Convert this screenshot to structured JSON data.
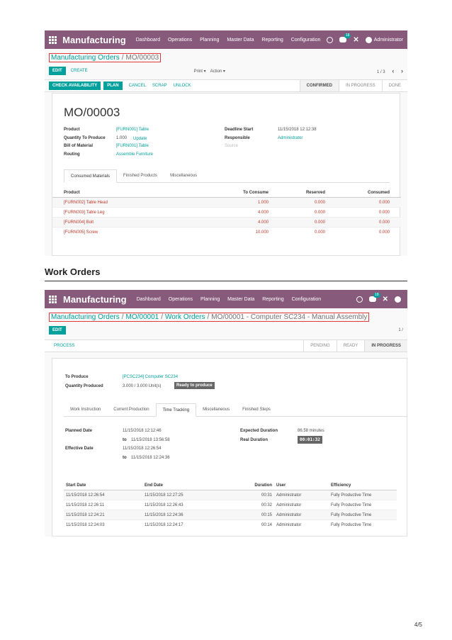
{
  "section_heading": "Work Orders",
  "page_number": "4/5",
  "screen1": {
    "topbar": {
      "brand": "Manufacturing",
      "menu": [
        "Dashboard",
        "Operations",
        "Planning",
        "Master Data",
        "Reporting",
        "Configuration"
      ],
      "chat_badge": "18",
      "user": "Administrator"
    },
    "breadcrumb": {
      "link": "Manufacturing Orders",
      "sep": "/",
      "current": "MO/00003"
    },
    "buttons": {
      "edit": "EDIT",
      "create": "CREATE",
      "print": "Print ▾",
      "action": "Action ▾"
    },
    "pager": {
      "text": "1 / 3",
      "prev": "‹",
      "next": "›"
    },
    "actions": {
      "check": "CHECK AVAILABILITY",
      "plan": "PLAN",
      "cancel": "CANCEL",
      "scrap": "SCRAP",
      "unlock": "UNLOCK"
    },
    "stages": [
      "CONFIRMED",
      "IN PROGRESS",
      "DONE"
    ],
    "record_title": "MO/00003",
    "fields": {
      "product_label": "Product",
      "product": "[FURN001] Table",
      "qty_label": "Quantity To Produce",
      "qty": "1.000",
      "qty_update": "Update",
      "bom_label": "Bill of Material",
      "bom": "[FURN001] Table",
      "routing_label": "Routing",
      "routing": "Assemble Furniture",
      "deadline_label": "Deadline Start",
      "deadline": "11/15/2018 12:12:38",
      "responsible_label": "Responsible",
      "responsible": "Administrator",
      "source_label": "Source"
    },
    "tabs": [
      "Consumed Materials",
      "Finished Products",
      "Miscellaneous"
    ],
    "table": {
      "headers": [
        "Product",
        "To Consume",
        "Reserved",
        "Consumed"
      ],
      "rows": [
        [
          "[FURN002] Table Head",
          "1.000",
          "0.000",
          "0.000"
        ],
        [
          "[FURN003] Table Leg",
          "4.000",
          "0.000",
          "0.000"
        ],
        [
          "[FURN004] Bolt",
          "4.000",
          "0.000",
          "0.000"
        ],
        [
          "[FURN005] Screw",
          "10.000",
          "0.000",
          "0.000"
        ]
      ]
    }
  },
  "screen2": {
    "topbar": {
      "brand": "Manufacturing",
      "menu": [
        "Dashboard",
        "Operations",
        "Planning",
        "Master Data",
        "Reporting",
        "Configuration"
      ],
      "chat_badge": "18"
    },
    "breadcrumb": [
      "Manufacturing Orders",
      "MO/00001",
      "Work Orders",
      "MO/00001 - Computer SC234 - Manual Assembly"
    ],
    "buttons": {
      "edit": "EDIT"
    },
    "pager": "1 /",
    "actions": {
      "process": "PROCESS"
    },
    "stages": [
      "PENDING",
      "READY",
      "IN PROGRESS"
    ],
    "fields": {
      "to_produce_label": "To Produce",
      "to_produce": "[PCSC234] Computer SC234",
      "qty_label": "Quantity Produced",
      "qty": "3.000  /  3.000 Unit(s)",
      "ready_badge": "Ready to produce",
      "planned_label": "Planned Date",
      "planned_from": "11/15/2018 12:12:46",
      "to": "to",
      "planned_to": "11/15/2018 13:56:58",
      "effective_label": "Effective Date",
      "effective_from": "11/15/2018 12:26:54",
      "effective_to": "11/15/2018 12:24:36",
      "expected_label": "Expected Duration",
      "expected": "86.58 minutes",
      "real_label": "Real Duration",
      "real": "00:01:32"
    },
    "tabs": [
      "Work Instruction",
      "Current Production",
      "Time Tracking",
      "Miscellaneous",
      "Finished Steps"
    ],
    "table": {
      "headers": [
        "Start Date",
        "End Date",
        "Duration",
        "User",
        "Efficiency"
      ],
      "rows": [
        [
          "11/15/2018 12:26:54",
          "11/15/2018 12:27:25",
          "00:31",
          "Administrator",
          "Fully Productive Time"
        ],
        [
          "11/15/2018 12:26:11",
          "11/15/2018 12:26:43",
          "00:32",
          "Administrator",
          "Fully Productive Time"
        ],
        [
          "11/15/2018 12:24:21",
          "11/15/2018 12:24:36",
          "00:15",
          "Administrator",
          "Fully Productive Time"
        ],
        [
          "11/15/2018 12:24:03",
          "11/15/2018 12:24:17",
          "00:14",
          "Administrator",
          "Fully Productive Time"
        ]
      ]
    }
  }
}
